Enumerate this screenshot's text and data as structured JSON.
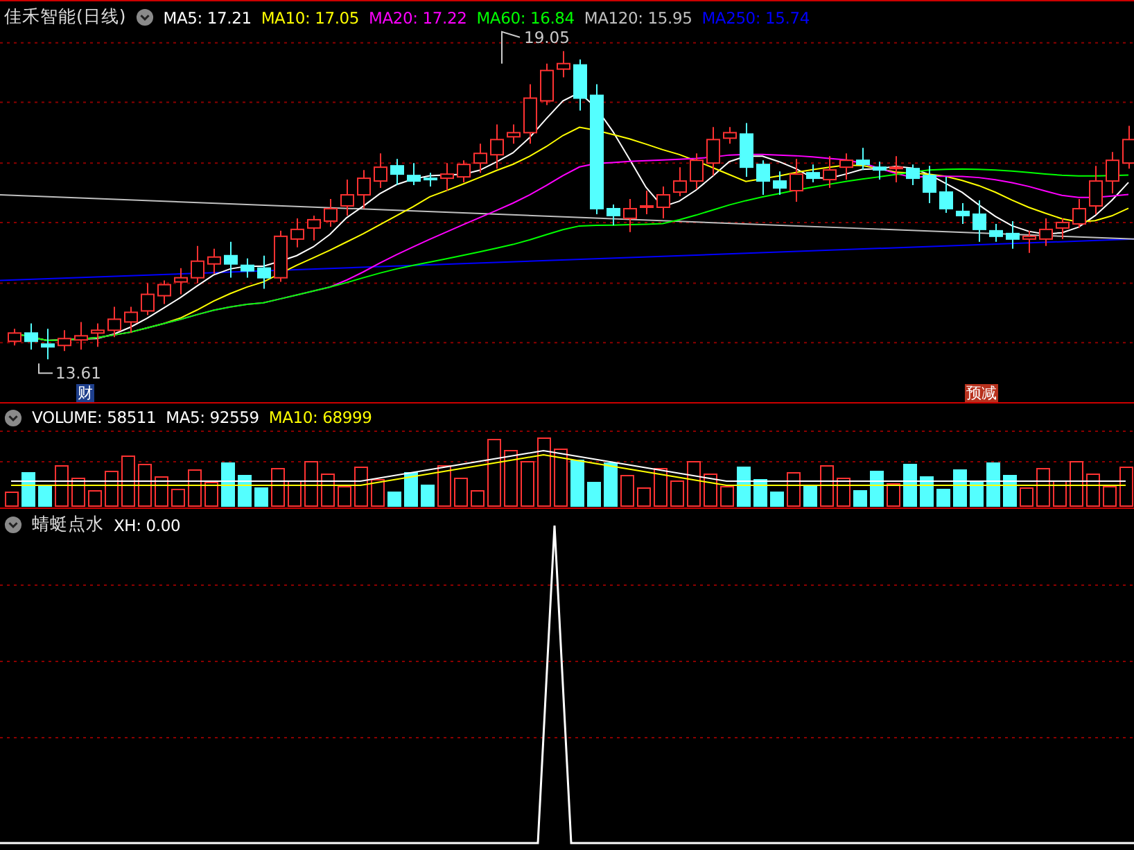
{
  "main_panel": {
    "stock_name": "佳禾智能(日线)",
    "indicators": [
      {
        "label": "MA5: 17.21",
        "color": "#ffffff"
      },
      {
        "label": "MA10: 17.05",
        "color": "#ffff00"
      },
      {
        "label": "MA20: 17.22",
        "color": "#ff00ff"
      },
      {
        "label": "MA60: 16.84",
        "color": "#00ff00"
      },
      {
        "label": "MA120: 15.95",
        "color": "#c0c0c0"
      },
      {
        "label": "MA250: 15.74",
        "color": "#0000ff"
      }
    ],
    "high_label": "19.05",
    "low_label": "13.61",
    "markers": [
      {
        "text": "财",
        "color": "#1e3f8c"
      },
      {
        "text": "预减",
        "color": "#b8321e"
      }
    ]
  },
  "volume_panel": {
    "indicators": [
      {
        "label": "VOLUME: 58511",
        "color": "#ffffff"
      },
      {
        "label": "MA5: 92559",
        "color": "#ffffff"
      },
      {
        "label": "MA10: 68999",
        "color": "#ffff00"
      }
    ]
  },
  "indicator_panel": {
    "title": "蜻蜓点水",
    "indicators": [
      {
        "label": "XH: 0.00",
        "color": "#ffffff"
      }
    ]
  }
}
